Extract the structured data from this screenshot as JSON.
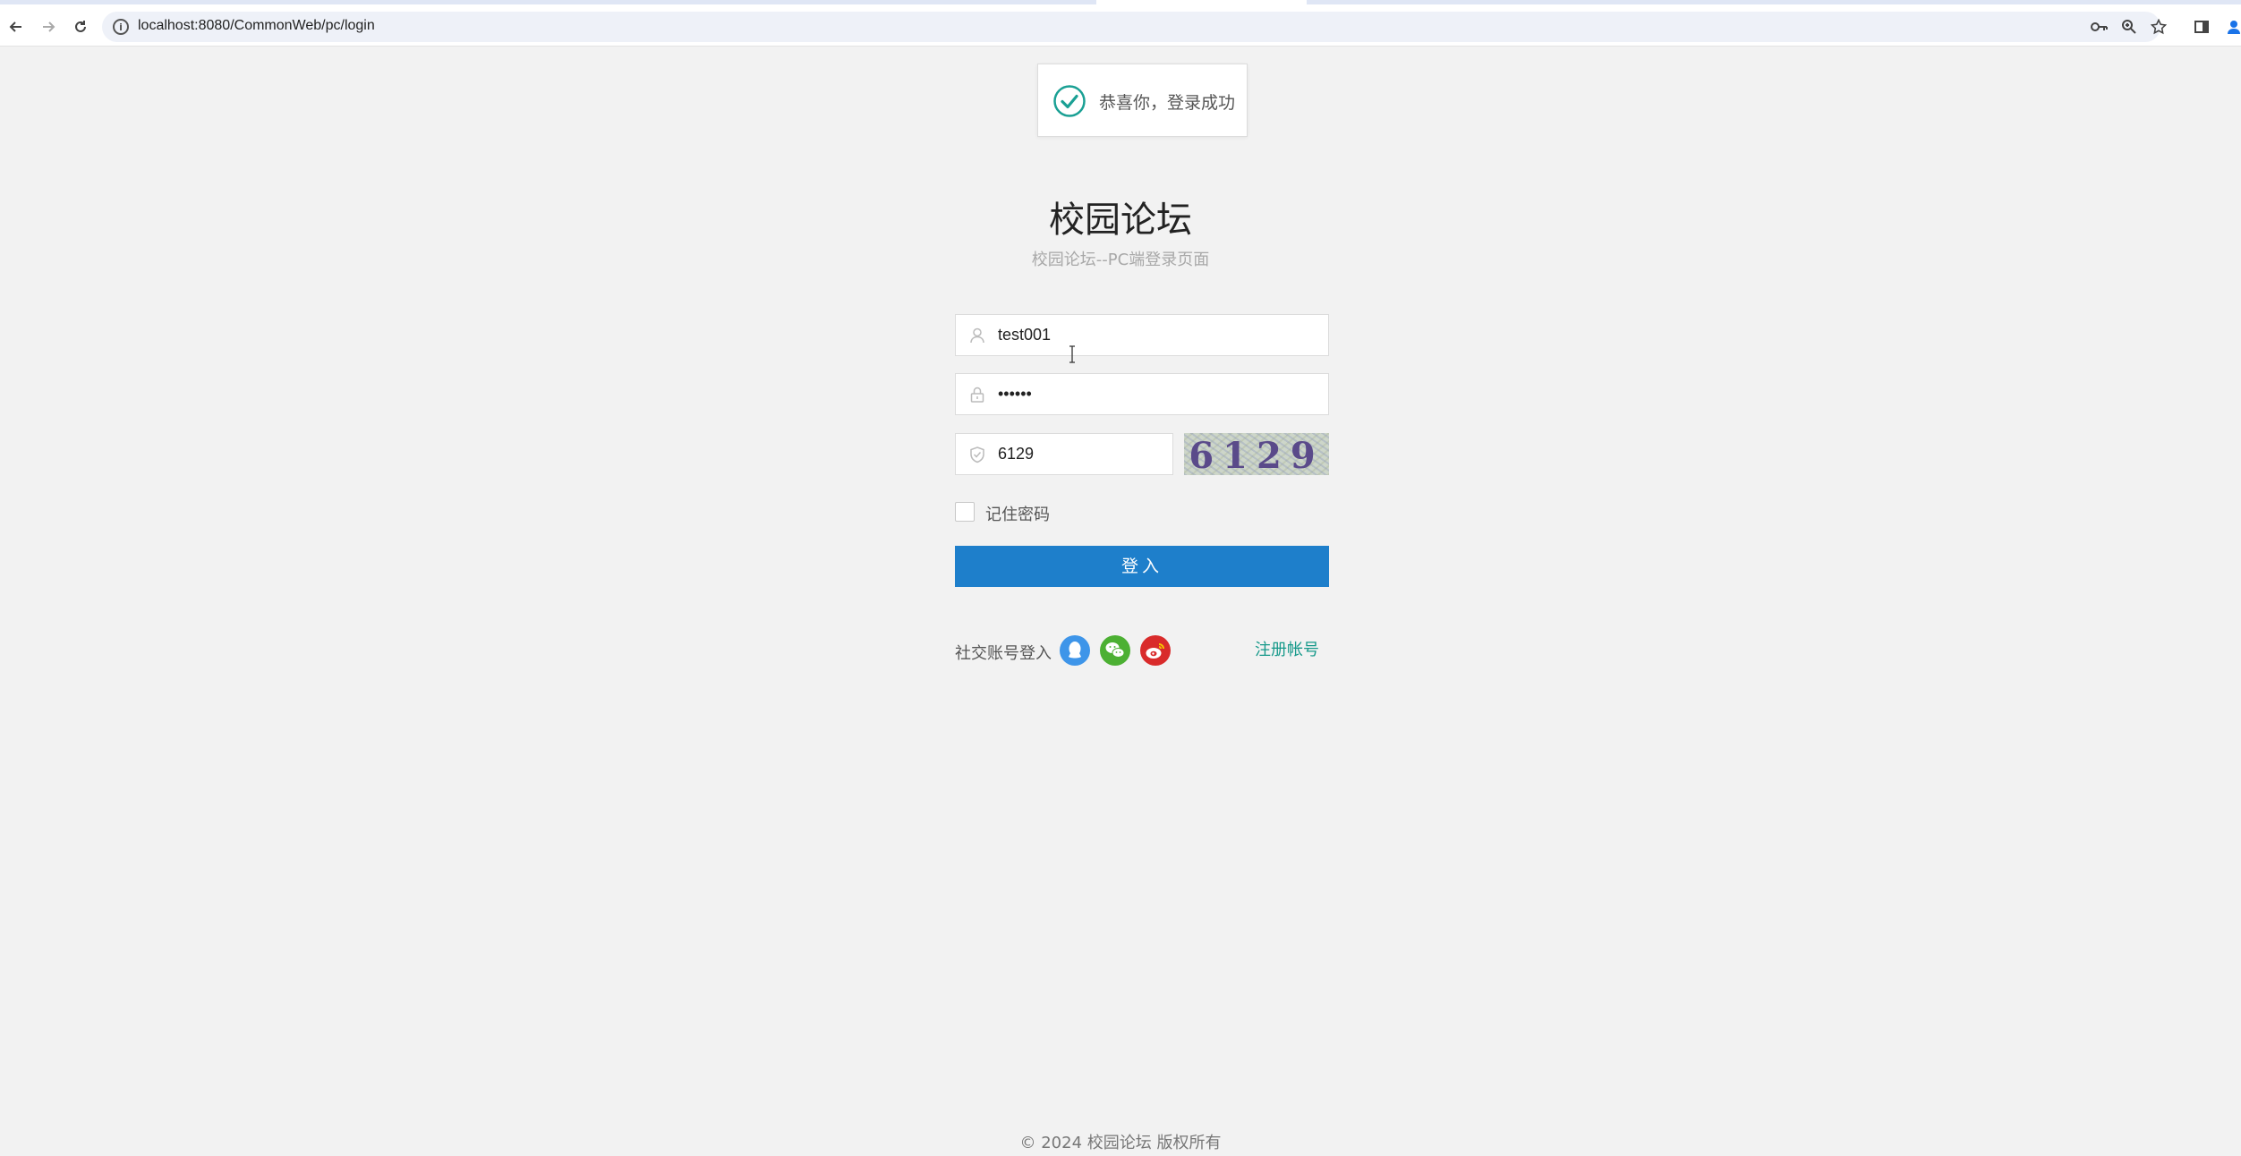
{
  "browser": {
    "url": "localhost:8080/CommonWeb/pc/login",
    "back_icon": "arrow-left-icon",
    "forward_icon": "arrow-right-icon",
    "reload_icon": "reload-icon",
    "info_icon": "info-icon",
    "key_icon": "key-icon",
    "zoom_icon": "zoom-icon",
    "bookmark_icon": "star-icon",
    "sidepanel_icon": "side-panel-icon",
    "profile_icon": "profile-icon"
  },
  "toast": {
    "message": "恭喜你，登录成功",
    "icon": "check-circle-icon",
    "color": "#1aa094"
  },
  "login": {
    "title": "校园论坛",
    "subtitle": "校园论坛--PC端登录页面",
    "username_value": "test001",
    "password_value": "••••••",
    "captcha_value": "6129",
    "captcha_image_text": "6129",
    "remember_label": "记住密码",
    "remember_checked": false,
    "submit_label": "登入"
  },
  "social": {
    "label": "社交账号登入",
    "items": [
      {
        "icon": "qq-icon",
        "color": "#3e95e9"
      },
      {
        "icon": "wechat-icon",
        "color": "#4cb033"
      },
      {
        "icon": "weibo-icon",
        "color": "#d92b2b"
      }
    ],
    "register_label": "注册帐号"
  },
  "footer": {
    "text": "© 2024 校园论坛 版权所有"
  },
  "colors": {
    "background": "#f2f2f2",
    "primary": "#1e7fcb",
    "link": "#16998a"
  }
}
